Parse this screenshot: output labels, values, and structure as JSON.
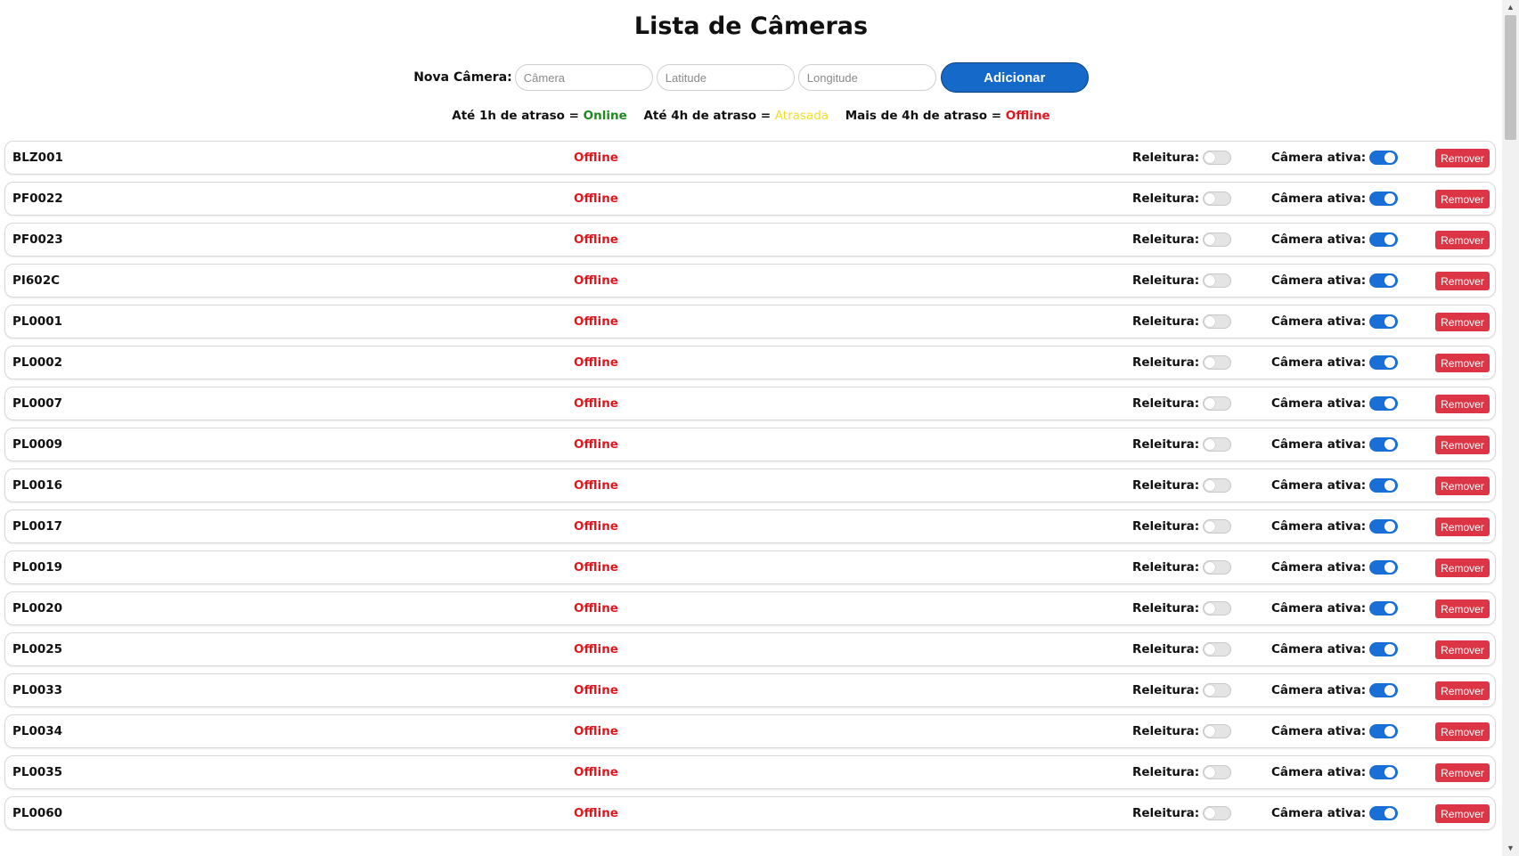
{
  "page": {
    "title": "Lista de Câmeras"
  },
  "form": {
    "label": "Nova Câmera:",
    "camera_placeholder": "Câmera",
    "latitude_placeholder": "Latitude",
    "longitude_placeholder": "Longitude",
    "add_button": "Adicionar"
  },
  "legend": {
    "online_prefix": "Até 1h de atraso = ",
    "online_label": "Online",
    "late_prefix": "Até 4h de atraso = ",
    "late_label": "Atrasada",
    "offline_prefix": "Mais de 4h de atraso = ",
    "offline_label": "Offline"
  },
  "colors": {
    "online": "#1e8a1e",
    "late": "#f0e020",
    "offline": "#e0161e",
    "primary": "#1469c9",
    "danger": "#dc3545"
  },
  "row_labels": {
    "reread": "Releitura:",
    "active": "Câmera ativa:",
    "remove": "Remover"
  },
  "cameras": [
    {
      "name": "BLZ001",
      "status": "Offline",
      "reread": false,
      "active": true
    },
    {
      "name": "PF0022",
      "status": "Offline",
      "reread": false,
      "active": true
    },
    {
      "name": "PF0023",
      "status": "Offline",
      "reread": false,
      "active": true
    },
    {
      "name": "PI602C",
      "status": "Offline",
      "reread": false,
      "active": true
    },
    {
      "name": "PL0001",
      "status": "Offline",
      "reread": false,
      "active": true
    },
    {
      "name": "PL0002",
      "status": "Offline",
      "reread": false,
      "active": true
    },
    {
      "name": "PL0007",
      "status": "Offline",
      "reread": false,
      "active": true
    },
    {
      "name": "PL0009",
      "status": "Offline",
      "reread": false,
      "active": true
    },
    {
      "name": "PL0016",
      "status": "Offline",
      "reread": false,
      "active": true
    },
    {
      "name": "PL0017",
      "status": "Offline",
      "reread": false,
      "active": true
    },
    {
      "name": "PL0019",
      "status": "Offline",
      "reread": false,
      "active": true
    },
    {
      "name": "PL0020",
      "status": "Offline",
      "reread": false,
      "active": true
    },
    {
      "name": "PL0025",
      "status": "Offline",
      "reread": false,
      "active": true
    },
    {
      "name": "PL0033",
      "status": "Offline",
      "reread": false,
      "active": true
    },
    {
      "name": "PL0034",
      "status": "Offline",
      "reread": false,
      "active": true
    },
    {
      "name": "PL0035",
      "status": "Offline",
      "reread": false,
      "active": true
    },
    {
      "name": "PL0060",
      "status": "Offline",
      "reread": false,
      "active": true
    }
  ]
}
